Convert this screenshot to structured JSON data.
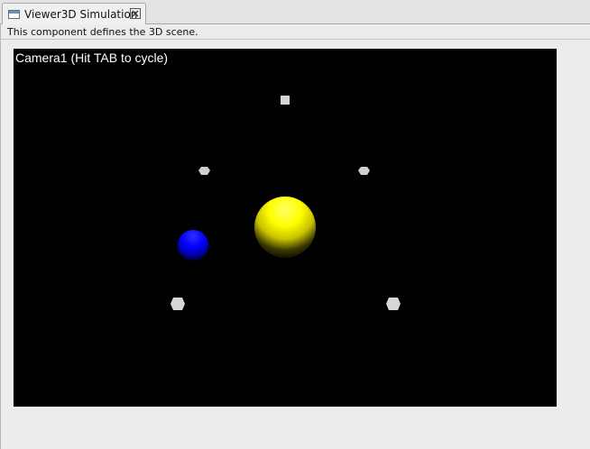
{
  "tab": {
    "title": "Viewer3D Simulation",
    "icon": "window-icon",
    "close_icon": "close-icon"
  },
  "panel": {
    "description": "This component defines the 3D scene."
  },
  "viewport": {
    "camera_label": "Camera1 (Hit TAB to cycle)",
    "background": "#000000",
    "objects": [
      {
        "name": "yellow-sphere",
        "color": "#ffff00"
      },
      {
        "name": "blue-sphere",
        "color": "#0000ff"
      },
      {
        "name": "light-marker",
        "color": "#d8d8d8"
      }
    ]
  }
}
